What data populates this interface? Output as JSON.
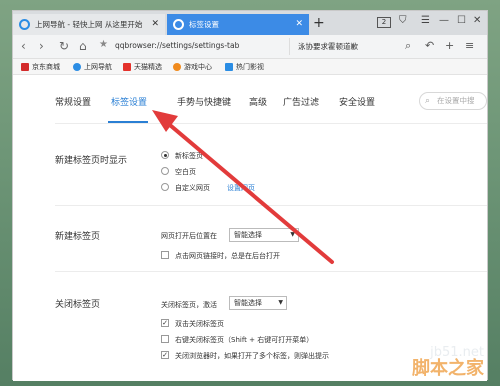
{
  "tabs": [
    {
      "label": "上网导航 - 轻快上网 从这里开始"
    },
    {
      "label": "标签设置"
    }
  ],
  "tab_count": "2",
  "address": {
    "url": "qqbrowser://settings/settings-tab",
    "search_text": "泳协要求霍顿道歉"
  },
  "bookmarks": [
    {
      "label": "京东商城",
      "color": "#d32a2a"
    },
    {
      "label": "上网导航",
      "color": "#2b8de4"
    },
    {
      "label": "天猫精选",
      "color": "#e4312b"
    },
    {
      "label": "游戏中心",
      "color": "#f08a1c"
    },
    {
      "label": "热门影视",
      "color": "#2b8de4"
    }
  ],
  "settings_tabs": [
    "常规设置",
    "标签设置",
    "手势与快捷键",
    "高级",
    "广告过滤",
    "安全设置"
  ],
  "settings_search_placeholder": "在设置中搜",
  "sections": {
    "new_tab": {
      "title": "新建标签页时显示",
      "options": [
        "新标签页",
        "空白页",
        "自定义网页"
      ],
      "selected": 0,
      "custom_link": "设置网页"
    },
    "open_tab": {
      "title": "新建标签页",
      "label": "网页打开后位置在",
      "select_value": "智能选择",
      "checkbox_label": "点击网页链接时，总是在后台打开",
      "checked": false
    },
    "close_tab": {
      "title": "关闭标签页",
      "label": "关闭标签页，激活",
      "select_value": "智能选择",
      "checkboxes": [
        {
          "label": "双击关闭标签页",
          "checked": true
        },
        {
          "label": "右键关闭标签页（Shift + 右键可打开菜单）",
          "checked": false
        },
        {
          "label": "关闭浏览器时，如果打开了多个标签，则弹出提示",
          "checked": true
        }
      ]
    }
  },
  "watermark": {
    "line1": "jb51.net",
    "line2": "脚本之家"
  },
  "colors": {
    "accent": "#2a7fd4",
    "tab_active": "#3c8be6",
    "annotation_arrow": "#e23b3b"
  }
}
